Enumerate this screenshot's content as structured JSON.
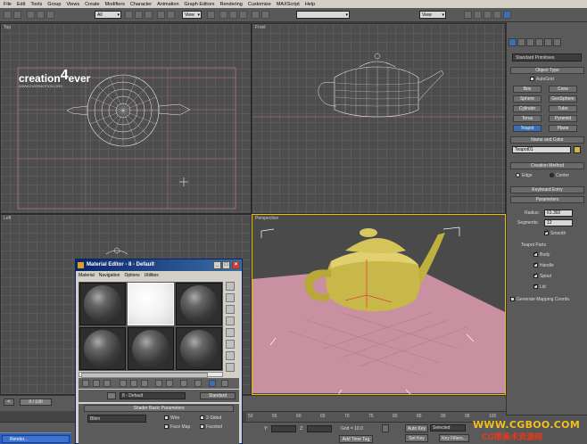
{
  "menu": [
    "File",
    "Edit",
    "Tools",
    "Group",
    "Views",
    "Create",
    "Modifiers",
    "Character",
    "Animation",
    "Graph Editors",
    "Rendering",
    "Customize",
    "MAXScript",
    "Help"
  ],
  "toolbar": {
    "selection_filter": "All",
    "ref_coord": "View",
    "ref_coord2": "View"
  },
  "viewports": {
    "top": "Top",
    "front": "Front",
    "left": "Left",
    "perspective": "Perspective"
  },
  "logo": {
    "name": "creation",
    "name2": "ever",
    "digit": "4",
    "site": "WWW.EVERMOTION.ORG"
  },
  "command_panel": {
    "category": "Standard Primitives",
    "object_type_header": "Object Type",
    "autogrid": "AutoGrid",
    "primitives": [
      "Box",
      "Cone",
      "Sphere",
      "GeoSphere",
      "Cylinder",
      "Tube",
      "Torus",
      "Pyramid",
      "Teapot",
      "Plane"
    ],
    "name_color_header": "Name and Color",
    "object_name": "Teapot01",
    "creation_method_header": "Creation Method",
    "edge": "Edge",
    "center": "Center",
    "keyboard_entry_header": "Keyboard Entry",
    "parameters_header": "Parameters",
    "radius_label": "Radius:",
    "radius_value": "61.392",
    "segments_label": "Segments:",
    "segments_value": "12",
    "smooth": "Smooth",
    "teapot_parts": "Teapot Parts",
    "parts": [
      "Body",
      "Handle",
      "Spout",
      "Lid"
    ],
    "gen_mapping": "Generate Mapping Coords."
  },
  "material_editor": {
    "title": "Material Editor - 8 - Default",
    "menu": [
      "Material",
      "Navigation",
      "Options",
      "Utilities"
    ],
    "material_name": "8 - Default",
    "type": "Standard",
    "shader_header": "Shader Basic Parameters",
    "shader": "Blinn",
    "wire": "Wire",
    "two_sided": "2-Sided",
    "face_map": "Face Map",
    "faceted": "Faceted"
  },
  "timeline": {
    "frame": "0 / 100"
  },
  "ruler": [
    "50",
    "55",
    "60",
    "65",
    "70",
    "75",
    "80",
    "85",
    "90",
    "95",
    "100"
  ],
  "status": {
    "y_label": "Y:",
    "z_label": "Z:",
    "grid": "Grid = 10.0",
    "auto_key": "Auto Key",
    "selected": "Selected",
    "set_key": "Set Key",
    "key_filters": "Key Filters...",
    "add_time_tag": "Add Time Tag"
  },
  "taskbar": {
    "item": "Render..."
  },
  "watermark": {
    "line1": "WWW.CGBOO.COM",
    "line2": "CG帮美术资源网"
  },
  "colors": {
    "teapot": "#c8b84a",
    "plane": "#c890a0",
    "active_border": "#e8c000"
  }
}
